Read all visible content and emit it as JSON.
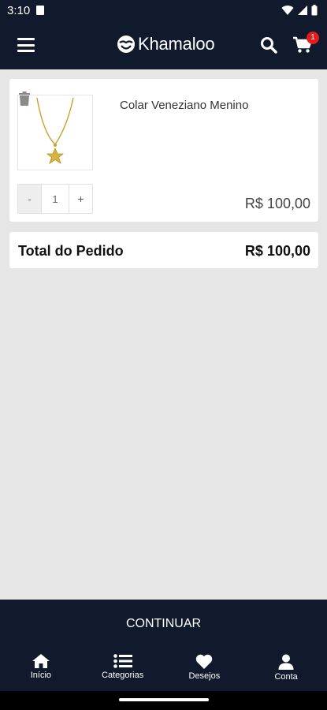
{
  "status_bar": {
    "time": "3:10",
    "icons": [
      "sim-card-icon",
      "wifi-icon",
      "signal-icon",
      "battery-icon"
    ]
  },
  "app_bar": {
    "brand": "Khamaloo",
    "icons": [
      "menu-icon",
      "logo-icon",
      "search-icon",
      "cart-icon"
    ],
    "cart_count": "1",
    "accent_color": "#101a2c",
    "badge_color": "#e21d1d"
  },
  "cart": {
    "items": [
      {
        "name": "Colar Veneziano Menino",
        "quantity": "1",
        "minus_label": "-",
        "plus_label": "+",
        "price": "R$  100,00",
        "image": "gold-star-necklace"
      }
    ],
    "total_label": "Total do Pedido",
    "total_value": "R$  100,00"
  },
  "continue_label": "CONTINUAR",
  "bottom_nav": {
    "items": [
      {
        "label": "Início",
        "icon": "home-icon"
      },
      {
        "label": "Categorias",
        "icon": "list-icon"
      },
      {
        "label": "Desejos",
        "icon": "heart-icon"
      },
      {
        "label": "Conta",
        "icon": "user-icon"
      }
    ]
  }
}
